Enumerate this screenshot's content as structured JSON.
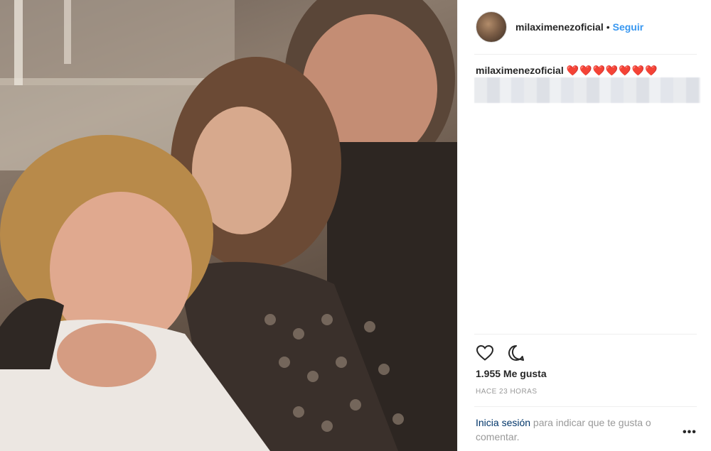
{
  "photo": {
    "alt": ""
  },
  "header": {
    "username": "milaximenezoficial",
    "separator": "•",
    "follow_label": "Seguir"
  },
  "caption": {
    "username": "milaximenezoficial",
    "text": "❤️❤️❤️❤️❤️❤️❤️"
  },
  "actions": {
    "like_icon": "heart-icon",
    "comment_icon": "comment-icon"
  },
  "likes": "1.955 Me gusta",
  "timestamp": "HACE 23 HORAS",
  "login_prompt": {
    "link_label": "Inicia sesión",
    "rest": " para indicar que te gusta o comentar."
  },
  "more_label": "•••",
  "colors": {
    "accent": "#3897f0",
    "link_dark": "#003569",
    "muted": "#999999",
    "text": "#262626"
  }
}
